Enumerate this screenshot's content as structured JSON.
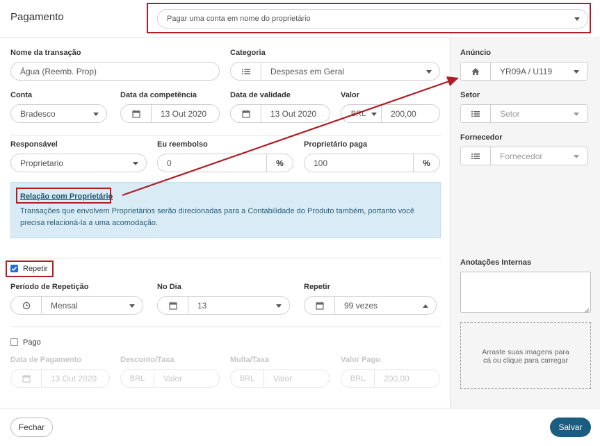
{
  "header": {
    "title": "Pagamento",
    "type_select": "Pagar uma conta em nome do proprietário"
  },
  "form": {
    "transaction_name": {
      "label": "Nome da transação",
      "value": "Água (Reemb. Prop)"
    },
    "category": {
      "label": "Categoria",
      "value": "Despesas em Geral"
    },
    "account": {
      "label": "Conta",
      "value": "Bradesco"
    },
    "competence_date": {
      "label": "Data da competência",
      "value": "13 Out 2020"
    },
    "due_date": {
      "label": "Data de validade",
      "value": "13 Out 2020"
    },
    "amount": {
      "label": "Valor",
      "currency": "BRL",
      "value": "200,00"
    },
    "responsible": {
      "label": "Responsável",
      "value": "Proprietario"
    },
    "reimburse": {
      "label": "Eu reembolso",
      "value": "0",
      "unit": "%"
    },
    "owner_pays": {
      "label": "Proprietário paga",
      "value": "100",
      "unit": "%"
    }
  },
  "info_box": {
    "title": "Relação com Proprietário",
    "text_line1": "Transações que envolvem Proprietários serão direcionadas para a Contabilidade do Produto também, portanto você",
    "text_line2": "precisa relacioná-la a uma acomodação."
  },
  "repeat": {
    "checkbox_label": "Repetir",
    "checked": true,
    "period": {
      "label": "Período de Repetição",
      "value": "Mensal"
    },
    "day": {
      "label": "No Dia",
      "value": "13"
    },
    "times": {
      "label": "Repetir",
      "value": "99 vezes"
    }
  },
  "paid": {
    "checkbox_label": "Pago",
    "checked": false,
    "payment_date": {
      "label": "Data de Pagamento",
      "value": "13 Out 2020"
    },
    "discount": {
      "label": "Desconto/Taxa",
      "currency": "BRL",
      "placeholder": "Valor"
    },
    "fine": {
      "label": "Multa/Taxa",
      "currency": "BRL",
      "placeholder": "Valor"
    },
    "paid_amount": {
      "label": "Valor Pago",
      "currency": "BRL",
      "value": "200,00"
    }
  },
  "sidebar": {
    "listing": {
      "label": "Anúncio",
      "value": "YR09A / U119"
    },
    "sector": {
      "label": "Setor",
      "placeholder": "Setor"
    },
    "supplier": {
      "label": "Fornecedor",
      "placeholder": "Fornecedor"
    },
    "notes": {
      "label": "Anotações Internas",
      "value": ""
    },
    "upload_line1": "Arraste suas imagens para",
    "upload_line2": "cá ou clique para carregar"
  },
  "footer": {
    "close_label": "Fechar",
    "save_label": "Salvar"
  },
  "colors": {
    "accent": "#1a5d80",
    "annotation": "#b01d25",
    "info_bg": "#d9ecf5"
  }
}
